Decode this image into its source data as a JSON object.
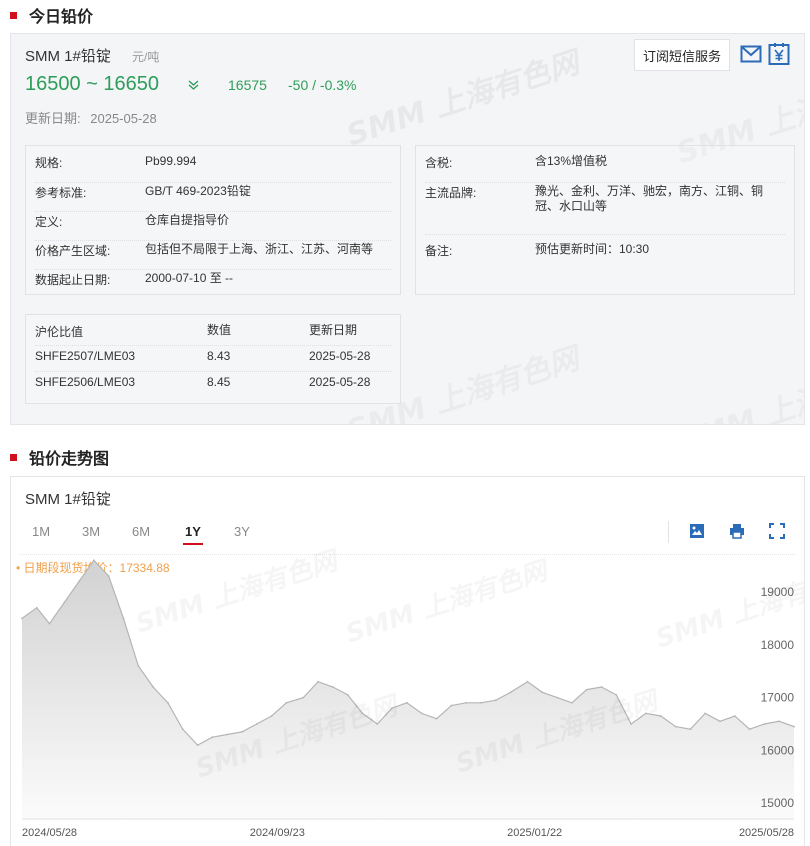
{
  "section1": {
    "title": "今日铅价"
  },
  "product": {
    "name": "SMM 1#铅锭",
    "unit": "元/吨",
    "price_range": "16500 ~ 16650",
    "avg": "16575",
    "change": "-50 / -0.3%",
    "update_label": "更新日期:",
    "update_date": "2025-05-28",
    "subscribe_label": "订阅短信服务"
  },
  "spec_left": [
    {
      "k": "规格:",
      "v": "Pb99.994"
    },
    {
      "k": "参考标准:",
      "v": "GB/T 469-2023铅锭"
    },
    {
      "k": "定义:",
      "v": "仓库自提指导价"
    },
    {
      "k": "价格产生区域:",
      "v": "包括但不局限于上海、浙江、江苏、河南等"
    },
    {
      "k": "数据起止日期:",
      "v": "2000-07-10 至 --"
    }
  ],
  "spec_right": [
    {
      "k": "含税:",
      "v": "含13%增值税"
    },
    {
      "k": "主流品牌:",
      "v": "豫光、金利、万洋、驰宏，南方、江铜、铜冠、水口山等"
    },
    {
      "k": "备注:",
      "v": "预估更新时间：10:30"
    }
  ],
  "ratio": {
    "headers": [
      "沪伦比值",
      "数值",
      "更新日期"
    ],
    "rows": [
      [
        "SHFE2507/LME03",
        "8.43",
        "2025-05-28"
      ],
      [
        "SHFE2506/LME03",
        "8.45",
        "2025-05-28"
      ]
    ]
  },
  "watermark": {
    "text": "SMM 上海有色网"
  },
  "section2": {
    "title": "铅价走势图"
  },
  "chart": {
    "title": "SMM 1#铅锭",
    "ranges": [
      "1M",
      "3M",
      "6M",
      "1Y",
      "3Y"
    ],
    "active_range": "1Y",
    "avg_label": "• 日期段现货均价：17334.88",
    "icons": [
      "image-download-icon",
      "print-icon",
      "fullscreen-icon"
    ]
  },
  "chart_data": {
    "type": "area",
    "title": "",
    "xlabel": "",
    "ylabel": "",
    "ylim": [
      14700,
      19700
    ],
    "y_ticks": [
      15000,
      16000,
      17000,
      18000,
      19000
    ],
    "x_ticks": [
      "2024/05/28",
      "2024/09/23",
      "2025/01/22",
      "2025/05/28"
    ],
    "grid": false,
    "colors": {
      "line": "#b5b5b5",
      "fill_top": "#d2d2d2",
      "fill_bottom": "#fbfbfb",
      "avg": "#f0a04b"
    },
    "series": [
      {
        "x": [
          "2024-05-28",
          "2024-06-04",
          "2024-06-10",
          "2024-06-17",
          "2024-06-24",
          "2024-07-01",
          "2024-07-08",
          "2024-07-15",
          "2024-07-22",
          "2024-07-29",
          "2024-08-05",
          "2024-08-12",
          "2024-08-19",
          "2024-08-26",
          "2024-09-02",
          "2024-09-09",
          "2024-09-16",
          "2024-09-23",
          "2024-09-30",
          "2024-10-08",
          "2024-10-15",
          "2024-10-22",
          "2024-10-29",
          "2024-11-05",
          "2024-11-12",
          "2024-11-19",
          "2024-11-26",
          "2024-12-03",
          "2024-12-10",
          "2024-12-17",
          "2024-12-24",
          "2024-12-31",
          "2025-01-07",
          "2025-01-14",
          "2025-01-22",
          "2025-01-29",
          "2025-02-05",
          "2025-02-12",
          "2025-02-19",
          "2025-02-26",
          "2025-03-05",
          "2025-03-12",
          "2025-03-19",
          "2025-03-26",
          "2025-04-02",
          "2025-04-09",
          "2025-04-16",
          "2025-04-23",
          "2025-04-30",
          "2025-05-07",
          "2025-05-14",
          "2025-05-21",
          "2025-05-28"
        ],
        "values": [
          18500,
          18700,
          18400,
          18800,
          19200,
          19600,
          19300,
          18500,
          17600,
          17200,
          16900,
          16400,
          16100,
          16250,
          16300,
          16350,
          16500,
          16650,
          16900,
          17000,
          17300,
          17200,
          17050,
          16700,
          16500,
          16800,
          16900,
          16700,
          16600,
          16850,
          16900,
          16900,
          16950,
          17100,
          17300,
          17100,
          17000,
          16900,
          17150,
          17200,
          17050,
          16500,
          16700,
          16650,
          16450,
          16400,
          16700,
          16550,
          16650,
          16400,
          16500,
          16550,
          16450
        ]
      }
    ]
  }
}
